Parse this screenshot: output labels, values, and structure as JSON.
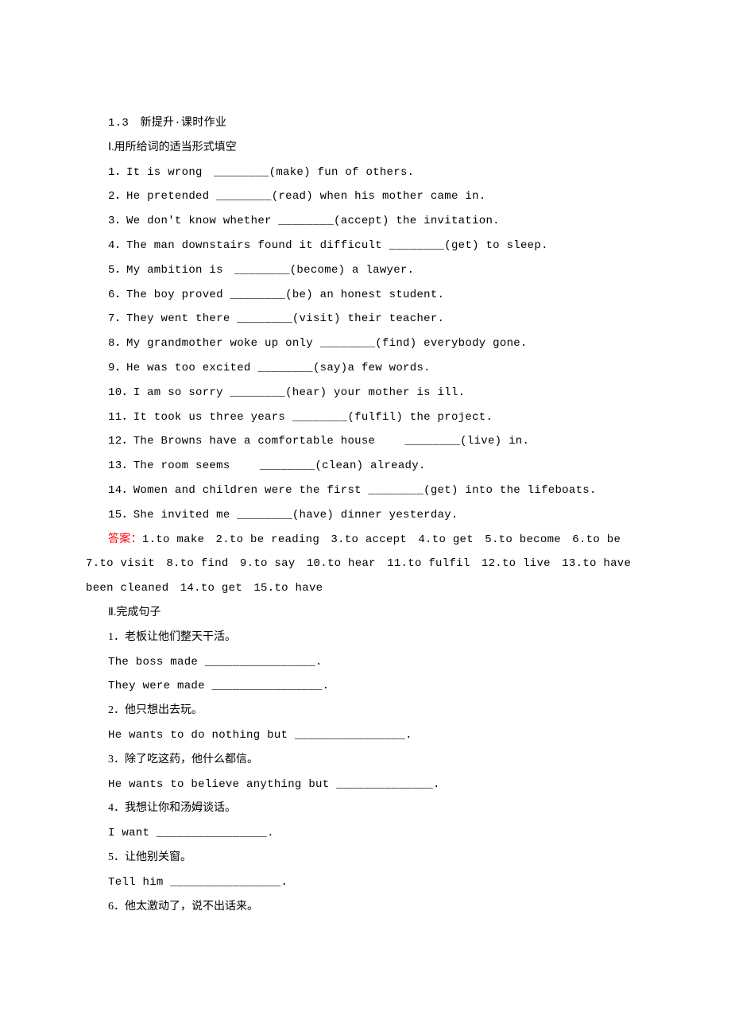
{
  "header": "1.3　新提升·课时作业",
  "section1": {
    "title": "Ⅰ.用所给词的适当形式填空",
    "items": [
      "1．It is wrong　________(make) fun of others.",
      "2．He pretended ________(read) when his mother came in.",
      "3．We don't know whether ________(accept) the invitation.",
      "4．The man downstairs found it difficult ________(get) to sleep.",
      "5．My ambition is　________(become) a lawyer.",
      "6．The boy proved ________(be) an honest student.",
      "7．They went there ________(visit) their teacher.",
      "8．My grandmother woke up only ________(find) everybody gone.",
      "9．He was too excited ________(say)a few words.",
      "10．I am so sorry ________(hear) your mother is ill.",
      "11．It took us three years ________(fulfil) the project.",
      "12．The Browns have a comfortable house 　　________(live) in.",
      "13．The room seems 　　________(clean) already.",
      "14．Women and children were the first ________(get) into the lifeboats.",
      "15．She invited me ________(have) dinner yesterday."
    ],
    "answer_label": "答案：",
    "answer_text_line1": "1.to make　2.to be reading　3.to accept　4.to get　5.to become　6.to be",
    "answer_text_line2": "7.to visit　8.to find　9.to say　10.to hear　11.to fulfil　12.to live　13.to have",
    "answer_text_line3": "been cleaned　14.to get　15.to have"
  },
  "section2": {
    "title": "Ⅱ.完成句子",
    "items": [
      {
        "zh": "1．老板让他们整天干活。",
        "en": [
          "The boss made ________________.",
          "They were made ________________."
        ]
      },
      {
        "zh": "2．他只想出去玩。",
        "en": [
          "He wants to do nothing but ________________."
        ]
      },
      {
        "zh": "3．除了吃这药，他什么都信。",
        "en": [
          "He wants to believe anything but ______________."
        ]
      },
      {
        "zh": "4．我想让你和汤姆谈话。",
        "en": [
          "I want ________________."
        ]
      },
      {
        "zh": "5．让他别关窗。",
        "en": [
          "Tell him ________________."
        ]
      },
      {
        "zh": "6．他太激动了，说不出话来。",
        "en": []
      }
    ]
  }
}
